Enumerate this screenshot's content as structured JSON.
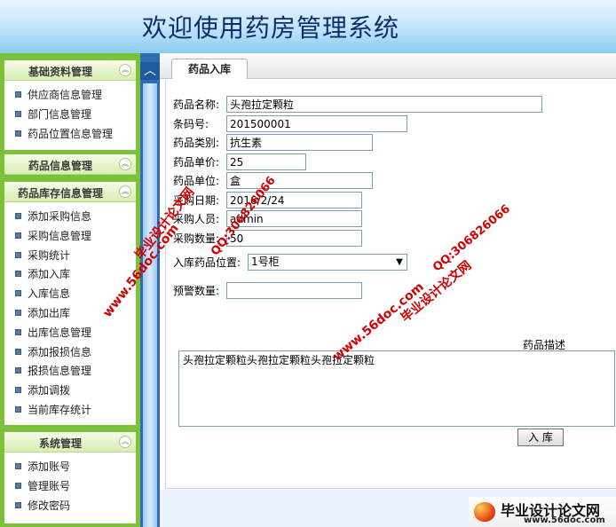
{
  "header": {
    "title": "欢迎使用药房管理系统"
  },
  "sidebar": {
    "panels": [
      {
        "title": "基础资料管理",
        "items": [
          "供应商信息管理",
          "部门信息管理",
          "药品位置信息管理"
        ]
      },
      {
        "title": "药品信息管理",
        "items": []
      },
      {
        "title": "药品库存信息管理",
        "items": [
          "添加采购信息",
          "采购信息管理",
          "采购统计",
          "添加入库",
          "入库信息",
          "添加出库",
          "出库信息管理",
          "添加报损信息",
          "报损信息管理",
          "添加调拨",
          "当前库存统计"
        ]
      },
      {
        "title": "系统管理",
        "items": [
          "添加账号",
          "管理账号",
          "修改密码"
        ]
      }
    ],
    "collapse_glyph": "︽",
    "scroll_up_glyph": "︿"
  },
  "tab": {
    "label": "药品入库"
  },
  "form": {
    "name_label": "药品名称:",
    "name_value": "头孢拉定颗粒",
    "barcode_label": "条码号:",
    "barcode_value": "201500001",
    "category_label": "药品类别:",
    "category_value": "抗生素",
    "price_label": "药品单价:",
    "price_value": "25",
    "unit_label": "药品单位:",
    "unit_value": "盒",
    "date_label": "采购日期:",
    "date_value": "2016/2/24",
    "buyer_label": "采购人员:",
    "buyer_value": "admin",
    "qty_label": "采购数量:",
    "qty_value": "50",
    "location_label": "入库药品位置:",
    "location_value": "1号柜",
    "alert_label": "预警数量:",
    "alert_value": "",
    "desc_label": "药品描述",
    "desc_value": "头孢拉定颗粒头孢拉定颗粒头孢拉定颗粒",
    "submit_label": "入 库"
  },
  "watermarks": {
    "site_name": "毕业设计论文网",
    "site_url": "www.56doc.com",
    "qq": "QQ:306826066",
    "badge_title": "毕业设计论文网",
    "badge_url": "www.56doc.com"
  }
}
